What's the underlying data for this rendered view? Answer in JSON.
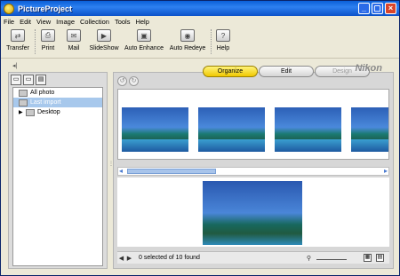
{
  "window": {
    "title": "PictureProject",
    "controls": [
      "_",
      "▢",
      "×"
    ]
  },
  "menu": [
    "File",
    "Edit",
    "View",
    "Image",
    "Collection",
    "Tools",
    "Help"
  ],
  "toolbar": {
    "items": [
      {
        "label": "Transfer",
        "icon": "transfer-icon"
      },
      {
        "label": "Print",
        "icon": "print-icon"
      },
      {
        "label": "Mail",
        "icon": "mail-icon"
      },
      {
        "label": "SlideShow",
        "icon": "slideshow-icon"
      },
      {
        "label": "Auto Enhance",
        "icon": "auto-enhance-icon"
      },
      {
        "label": "Auto Redeye",
        "icon": "redeye-icon"
      },
      {
        "label": "Help",
        "icon": "help-icon"
      }
    ]
  },
  "tabs": [
    {
      "label": "Organize",
      "state": "active"
    },
    {
      "label": "Edit",
      "state": "normal"
    },
    {
      "label": "Design",
      "state": "disabled"
    }
  ],
  "brand": "Nikon",
  "tree": [
    {
      "label": "All photo",
      "selected": false
    },
    {
      "label": "Last import",
      "selected": true
    },
    {
      "label": "Desktop",
      "selected": false
    }
  ],
  "status": {
    "text": "0 selected of 10 found"
  },
  "colors": {
    "titlebar": "#0b5bd7",
    "active_tab": "#f5d800",
    "selection": "#a7c8ec"
  }
}
